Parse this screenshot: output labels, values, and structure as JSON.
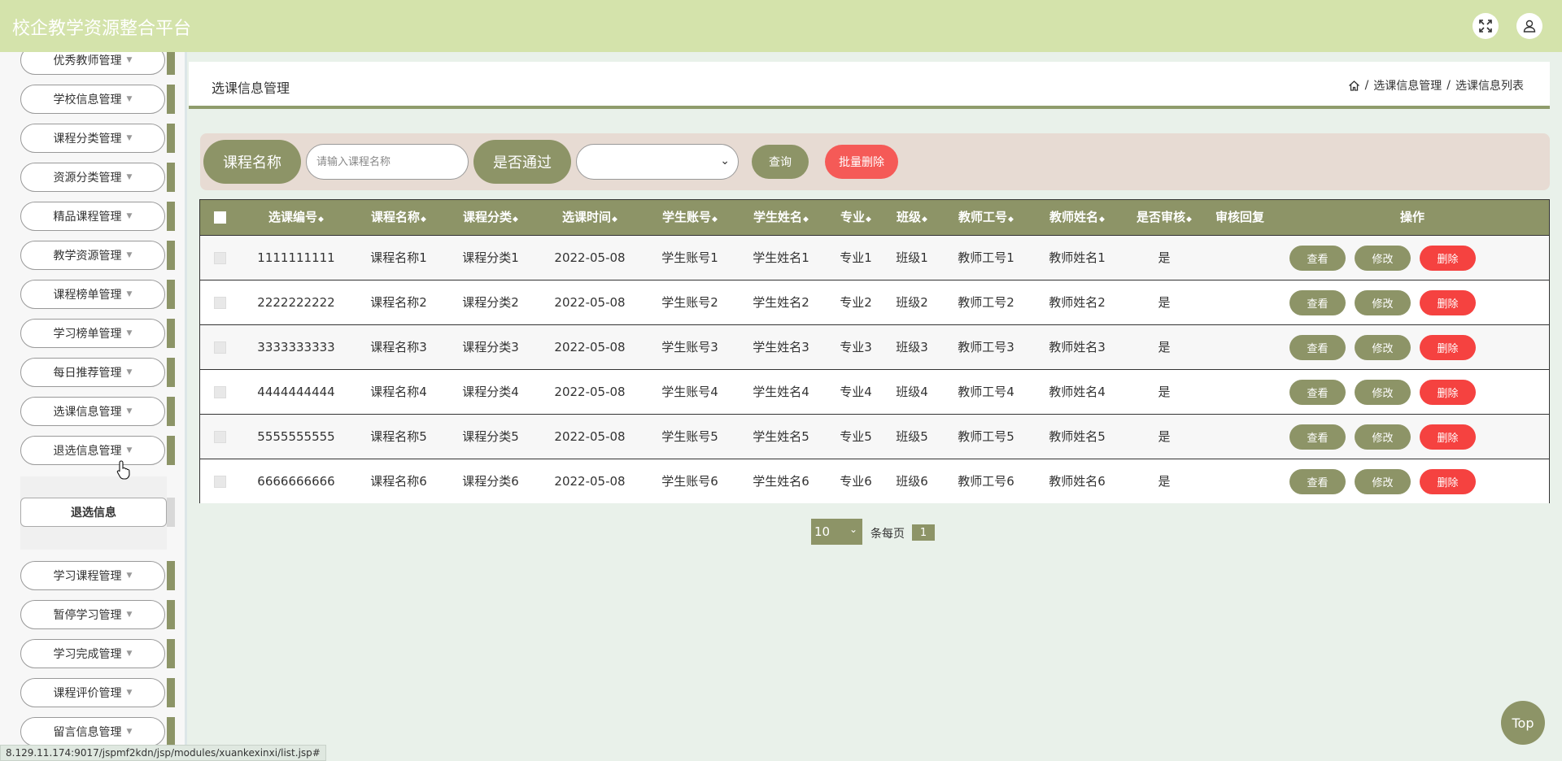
{
  "header": {
    "brand": "校企教学资源整合平台",
    "fullscreen_icon": "fullscreen-icon",
    "user_icon": "user-icon"
  },
  "sidebar": {
    "items_top": [
      {
        "label": "优秀教师管理"
      },
      {
        "label": "学校信息管理"
      },
      {
        "label": "课程分类管理"
      },
      {
        "label": "资源分类管理"
      },
      {
        "label": "精品课程管理"
      },
      {
        "label": "教学资源管理"
      },
      {
        "label": "课程榜单管理"
      },
      {
        "label": "学习榜单管理"
      },
      {
        "label": "每日推荐管理"
      },
      {
        "label": "选课信息管理"
      },
      {
        "label": "退选信息管理"
      }
    ],
    "submenu": {
      "label": "退选信息"
    },
    "items_bottom": [
      {
        "label": "学习课程管理"
      },
      {
        "label": "暂停学习管理"
      },
      {
        "label": "学习完成管理"
      },
      {
        "label": "课程评价管理"
      },
      {
        "label": "留言信息管理"
      }
    ]
  },
  "statusbar": {
    "url": "8.129.11.174:9017/jspmf2kdn/jsp/modules/xuankexinxi/list.jsp#"
  },
  "page": {
    "title": "选课信息管理",
    "breadcrumb": {
      "level1": "选课信息管理",
      "sep": "/",
      "level2": "选课信息列表"
    }
  },
  "search": {
    "course_label": "课程名称",
    "course_placeholder": "请输入课程名称",
    "pass_label": "是否通过",
    "pass_value": "",
    "query_label": "查询",
    "batch_delete_label": "批量删除"
  },
  "table": {
    "columns": [
      "选课编号",
      "课程名称",
      "课程分类",
      "选课时间",
      "学生账号",
      "学生姓名",
      "专业",
      "班级",
      "教师工号",
      "教师姓名",
      "是否审核",
      "审核回复",
      "操作"
    ],
    "rows": [
      [
        "1111111111",
        "课程名称1",
        "课程分类1",
        "2022-05-08",
        "学生账号1",
        "学生姓名1",
        "专业1",
        "班级1",
        "教师工号1",
        "教师姓名1",
        "是",
        ""
      ],
      [
        "2222222222",
        "课程名称2",
        "课程分类2",
        "2022-05-08",
        "学生账号2",
        "学生姓名2",
        "专业2",
        "班级2",
        "教师工号2",
        "教师姓名2",
        "是",
        ""
      ],
      [
        "3333333333",
        "课程名称3",
        "课程分类3",
        "2022-05-08",
        "学生账号3",
        "学生姓名3",
        "专业3",
        "班级3",
        "教师工号3",
        "教师姓名3",
        "是",
        ""
      ],
      [
        "4444444444",
        "课程名称4",
        "课程分类4",
        "2022-05-08",
        "学生账号4",
        "学生姓名4",
        "专业4",
        "班级4",
        "教师工号4",
        "教师姓名4",
        "是",
        ""
      ],
      [
        "5555555555",
        "课程名称5",
        "课程分类5",
        "2022-05-08",
        "学生账号5",
        "学生姓名5",
        "专业5",
        "班级5",
        "教师工号5",
        "教师姓名5",
        "是",
        ""
      ],
      [
        "6666666666",
        "课程名称6",
        "课程分类6",
        "2022-05-08",
        "学生账号6",
        "学生姓名6",
        "专业6",
        "班级6",
        "教师工号6",
        "教师姓名6",
        "是",
        ""
      ]
    ],
    "actions": {
      "view": "查看",
      "edit": "修改",
      "delete": "删除"
    }
  },
  "pagination": {
    "page_size": "10",
    "per_page_label": "条每页",
    "current_page": "1"
  },
  "top_button": "Top",
  "colors": {
    "topbar": "#d4e3ab",
    "accent": "#8d9467",
    "danger": "#f54240",
    "search_bg": "#e7dbd3",
    "page_bg": "#e9f1ea"
  }
}
